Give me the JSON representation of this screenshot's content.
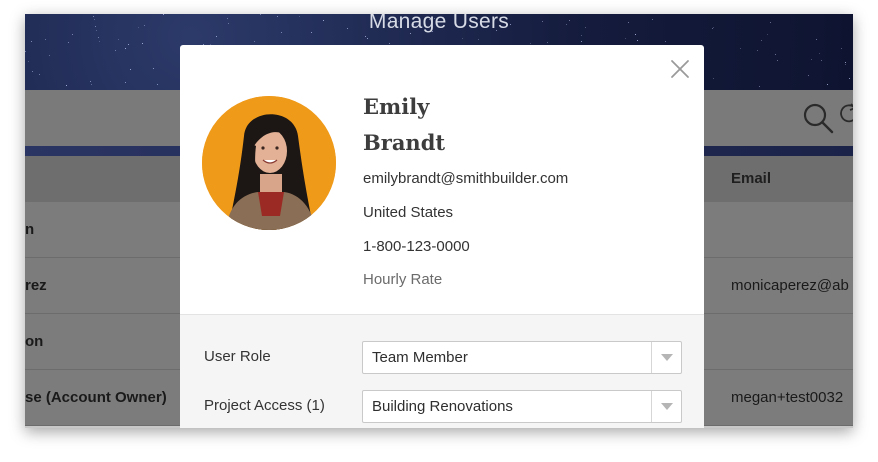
{
  "app": {
    "title": "Manage Users"
  },
  "table": {
    "email_column": "Email",
    "rows": [
      {
        "name": "n",
        "email": ""
      },
      {
        "name": "rez",
        "email": "monicaperez@ab"
      },
      {
        "name": "on",
        "email": ""
      },
      {
        "name": "se (Account Owner)",
        "email": "megan+test0032"
      }
    ]
  },
  "modal": {
    "first_name": "Emily",
    "last_name": "Brandt",
    "email": "emilybrandt@smithbuilder.com",
    "country": "United States",
    "phone": "1-800-123-0000",
    "rate_label": "Hourly Rate",
    "user_role_label": "User Role",
    "user_role_value": "Team Member",
    "project_access_label": "Project Access (1)",
    "project_access_value": "Building Renovations"
  },
  "colors": {
    "avatar_bg": "#f09a1a",
    "header_bg": "#141b3c",
    "overlay_gray": "#7c7c7c"
  },
  "icons": {
    "close": "close-icon",
    "search": "search-icon",
    "refresh": "refresh-icon",
    "caret": "chevron-down-icon"
  }
}
